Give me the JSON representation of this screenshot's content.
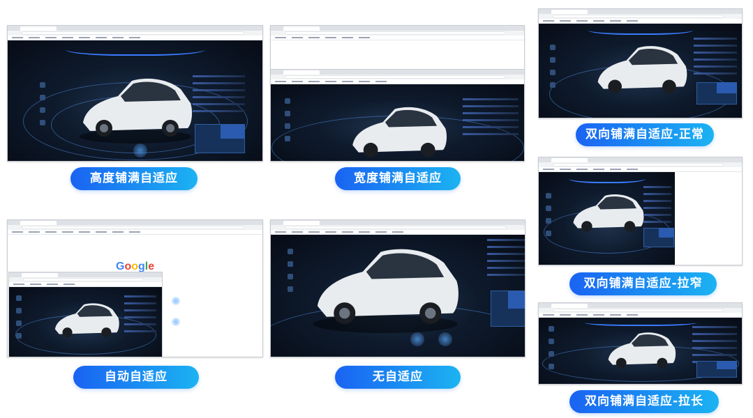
{
  "labels": {
    "height_fill": "高度铺满自适应",
    "width_fill": "宽度铺满自适应",
    "auto": "自动自适应",
    "none": "无自适应",
    "both_normal": "双向铺满自适应-正常",
    "both_narrow": "双向铺满自适应-拉窄",
    "both_long": "双向铺满自适应-拉长"
  },
  "google_text": "Google",
  "colors": {
    "label_gradient_start": "#1a63f2",
    "label_gradient_end": "#1bb3f2",
    "dashboard_bg": "#0b1220",
    "accent_blue": "#3b7cff"
  }
}
